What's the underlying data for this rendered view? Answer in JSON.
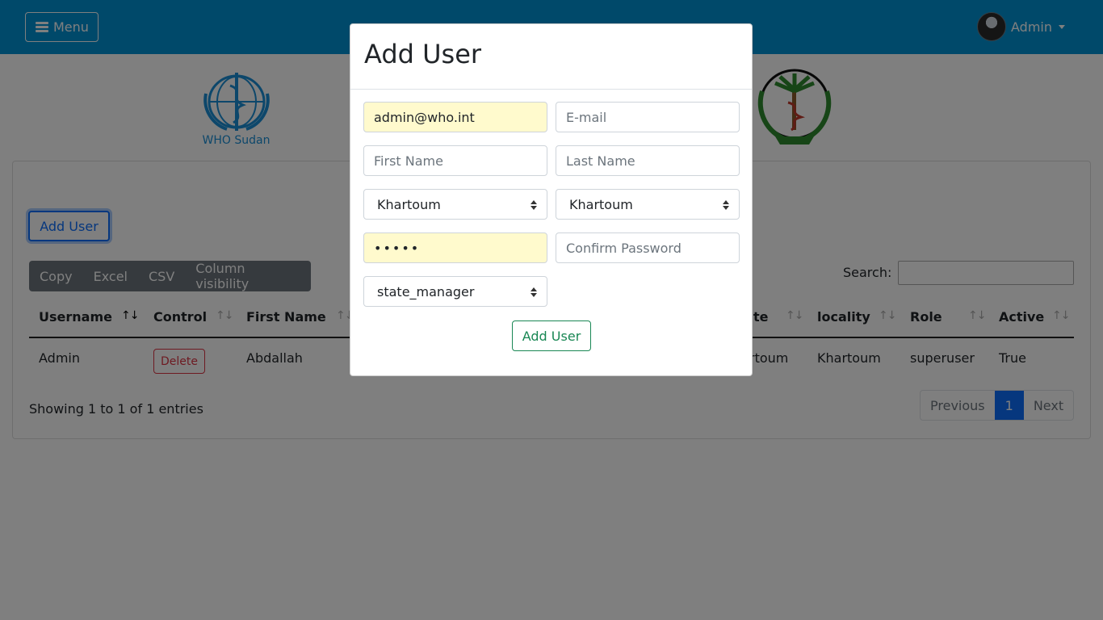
{
  "navbar": {
    "menu_label": "Menu",
    "user_label": "Admin",
    "brand_color": "#0093d5"
  },
  "logos": {
    "who_text": "WHO Sudan"
  },
  "page": {
    "add_user_label": "Add User",
    "export_buttons": [
      "Copy",
      "Excel",
      "CSV",
      "Column visibility"
    ],
    "search_label": "Search:",
    "search_value": ""
  },
  "table": {
    "columns": [
      "Username",
      "Control",
      "First Name",
      "te",
      "locality",
      "Role",
      "Active"
    ],
    "rows": [
      {
        "username": "Admin",
        "control": "Delete",
        "first_name": "Abdallah",
        "state_partial": "rtoum",
        "locality": "Khartoum",
        "role": "superuser",
        "active": "True"
      }
    ]
  },
  "footer": {
    "showing": "Showing 1 to 1 of 1 entries",
    "previous": "Previous",
    "current_page": "1",
    "next": "Next"
  },
  "modal": {
    "title": "Add User",
    "username_value": "admin@who.int",
    "email_placeholder": "E-mail",
    "first_name_placeholder": "First Name",
    "last_name_placeholder": "Last Name",
    "state_value": "Khartoum",
    "locality_value": "Khartoum",
    "password_value": "•••••",
    "confirm_password_placeholder": "Confirm Password",
    "role_value": "state_manager",
    "submit_label": "Add User"
  }
}
